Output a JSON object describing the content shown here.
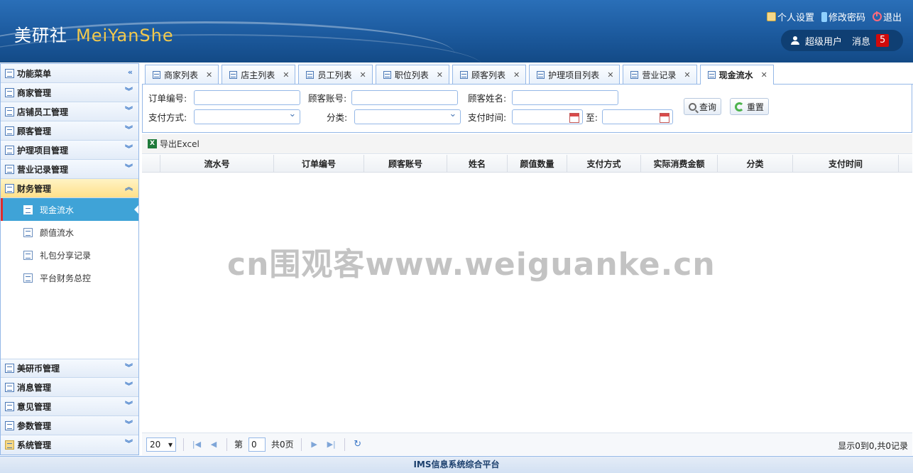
{
  "header": {
    "logo_cn": "美研社",
    "logo_en": "MeiYanShe",
    "links": {
      "settings": "个人设置",
      "password": "修改密码",
      "logout": "退出"
    },
    "user": "超级用户",
    "messages_label": "消息",
    "messages_count": "5"
  },
  "sidebar": {
    "title": "功能菜单",
    "top_items": [
      "商家管理",
      "店铺员工管理",
      "顾客管理",
      "护理项目管理",
      "营业记录管理"
    ],
    "active_group": "财务管理",
    "sub_items": [
      "现金流水",
      "颜值流水",
      "礼包分享记录",
      "平台财务总控"
    ],
    "bottom_items": [
      "美研币管理",
      "消息管理",
      "意见管理",
      "参数管理",
      "系统管理"
    ]
  },
  "tabs": [
    "商家列表",
    "店主列表",
    "员工列表",
    "职位列表",
    "顾客列表",
    "护理项目列表",
    "营业记录",
    "现金流水"
  ],
  "active_tab": "现金流水",
  "search": {
    "order_no": "订单编号:",
    "customer_account": "顾客账号:",
    "customer_name": "顾客姓名:",
    "pay_method": "支付方式:",
    "category": "分类:",
    "pay_time": "支付时间:",
    "to": "至:",
    "query_btn": "查询",
    "reset_btn": "重置"
  },
  "toolbar": {
    "export": "导出Excel"
  },
  "grid": {
    "columns": [
      "流水号",
      "订单编号",
      "顾客账号",
      "姓名",
      "颜值数量",
      "支付方式",
      "实际消费金额",
      "分类",
      "支付时间"
    ]
  },
  "watermark": "cn围观客www.weiguanke.cn",
  "pager": {
    "page_size": "20",
    "page_prefix": "第",
    "page_value": "0",
    "page_total": "共0页",
    "info": "显示0到0,共0记录"
  },
  "footer": "IMS信息系统综合平台"
}
